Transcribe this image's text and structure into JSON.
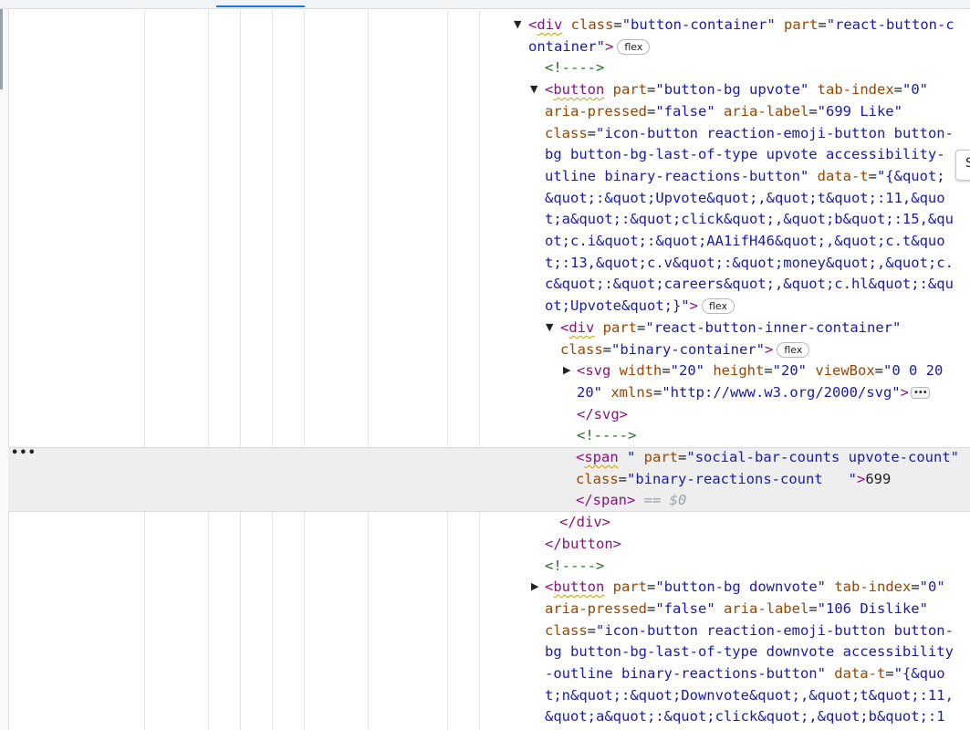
{
  "devtools": {
    "selected_row_menu": "•••",
    "edge_tooltip_text": "S",
    "lines": [
      {
        "toggle": "▼",
        "parts": [
          {
            "c": "tag",
            "t": "<"
          },
          {
            "c": "tag sq",
            "t": "div"
          },
          {
            "c": "an",
            "t": " class"
          },
          {
            "c": "tx",
            "t": "="
          },
          {
            "c": "av",
            "t": "\"button-container\""
          },
          {
            "c": "an",
            "t": " part"
          },
          {
            "c": "tx",
            "t": "="
          },
          {
            "c": "av",
            "t": "\"react-button-c"
          }
        ]
      },
      {
        "parts": [
          {
            "c": "av",
            "t": "ontainer\""
          },
          {
            "c": "tag",
            "t": ">"
          },
          {
            "c": "badge",
            "t": "flex"
          }
        ]
      },
      {
        "parts": [
          {
            "c": "cm",
            "t": "<!---->"
          }
        ]
      },
      {
        "toggle": "▼",
        "parts": [
          {
            "c": "tag",
            "t": "<"
          },
          {
            "c": "tag sq",
            "t": "button"
          },
          {
            "c": "an",
            "t": " part"
          },
          {
            "c": "tx",
            "t": "="
          },
          {
            "c": "av",
            "t": "\"button-bg upvote\""
          },
          {
            "c": "an",
            "t": " tab-index"
          },
          {
            "c": "tx",
            "t": "="
          },
          {
            "c": "av",
            "t": "\"0\""
          }
        ]
      },
      {
        "parts": [
          {
            "c": "an",
            "t": "aria-pressed"
          },
          {
            "c": "tx",
            "t": "="
          },
          {
            "c": "av",
            "t": "\"false\""
          },
          {
            "c": "an",
            "t": " aria-label"
          },
          {
            "c": "tx",
            "t": "="
          },
          {
            "c": "av",
            "t": "\"699 Like\""
          }
        ]
      },
      {
        "parts": [
          {
            "c": "an",
            "t": "class"
          },
          {
            "c": "tx",
            "t": "="
          },
          {
            "c": "av",
            "t": "\"icon-button reaction-emoji-button button-"
          }
        ]
      },
      {
        "parts": [
          {
            "c": "av",
            "t": "bg button-bg-last-of-type upvote accessibility-"
          }
        ]
      },
      {
        "parts": [
          {
            "c": "av",
            "t": "utline binary-reactions-button\""
          },
          {
            "c": "an",
            "t": " data-t"
          },
          {
            "c": "tx",
            "t": "="
          },
          {
            "c": "av",
            "t": "\"{&quot;"
          }
        ]
      },
      {
        "parts": [
          {
            "c": "av",
            "t": "&quot;:&quot;Upvote&quot;,&quot;t&quot;:11,&quo"
          }
        ]
      },
      {
        "parts": [
          {
            "c": "av",
            "t": "t;a&quot;:&quot;click&quot;,&quot;b&quot;:15,&qu"
          }
        ]
      },
      {
        "parts": [
          {
            "c": "av",
            "t": "ot;c.i&quot;:&quot;AA1ifH46&quot;,&quot;c.t&quo"
          }
        ]
      },
      {
        "parts": [
          {
            "c": "av",
            "t": "t;:13,&quot;c.v&quot;:&quot;money&quot;,&quot;c."
          }
        ]
      },
      {
        "parts": [
          {
            "c": "av",
            "t": "c&quot;:&quot;careers&quot;,&quot;c.hl&quot;:&qu"
          }
        ]
      },
      {
        "parts": [
          {
            "c": "av",
            "t": "ot;Upvote&quot;}\""
          },
          {
            "c": "tag",
            "t": ">"
          },
          {
            "c": "badge",
            "t": "flex"
          }
        ]
      },
      {
        "toggle": "▼",
        "parts": [
          {
            "c": "tag",
            "t": "<"
          },
          {
            "c": "tag sq",
            "t": "div"
          },
          {
            "c": "an",
            "t": " part"
          },
          {
            "c": "tx",
            "t": "="
          },
          {
            "c": "av",
            "t": "\"react-button-inner-container\""
          }
        ]
      },
      {
        "parts": [
          {
            "c": "an",
            "t": "class"
          },
          {
            "c": "tx",
            "t": "="
          },
          {
            "c": "av",
            "t": "\"binary-container\""
          },
          {
            "c": "tag",
            "t": ">"
          },
          {
            "c": "badge",
            "t": "flex"
          }
        ]
      },
      {
        "toggle": "▶",
        "parts": [
          {
            "c": "tag",
            "t": "<svg"
          },
          {
            "c": "an",
            "t": " width"
          },
          {
            "c": "tx",
            "t": "="
          },
          {
            "c": "av",
            "t": "\"20\""
          },
          {
            "c": "an",
            "t": " height"
          },
          {
            "c": "tx",
            "t": "="
          },
          {
            "c": "av",
            "t": "\"20\""
          },
          {
            "c": "an",
            "t": " viewBox"
          },
          {
            "c": "tx",
            "t": "="
          },
          {
            "c": "av",
            "t": "\"0 0 20"
          }
        ]
      },
      {
        "parts": [
          {
            "c": "av",
            "t": "20\""
          },
          {
            "c": "an",
            "t": " xmlns"
          },
          {
            "c": "tx",
            "t": "="
          },
          {
            "c": "av",
            "t": "\"http://www.w3.org/2000/svg\""
          },
          {
            "c": "tag",
            "t": ">"
          },
          {
            "c": "dots",
            "t": "•••"
          }
        ]
      },
      {
        "parts": [
          {
            "c": "tag",
            "t": "</svg>"
          }
        ]
      },
      {
        "parts": [
          {
            "c": "cm",
            "t": "<!---->"
          }
        ]
      },
      {
        "parts": [
          {
            "c": "tag",
            "t": "<"
          },
          {
            "c": "tag sq",
            "t": "span"
          },
          {
            "c": "av",
            "t": " \""
          },
          {
            "c": "an",
            "t": " part"
          },
          {
            "c": "tx",
            "t": "="
          },
          {
            "c": "av",
            "t": "\"social-bar-counts upvote-count\""
          }
        ]
      },
      {
        "parts": [
          {
            "c": "an",
            "t": "class"
          },
          {
            "c": "tx",
            "t": "="
          },
          {
            "c": "av",
            "t": "\"binary-reactions-count   \""
          },
          {
            "c": "tag",
            "t": ">"
          },
          {
            "c": "tx",
            "t": "699"
          }
        ]
      },
      {
        "parts": [
          {
            "c": "tag",
            "t": "</span>"
          },
          {
            "c": "dim",
            "t": " == $0"
          }
        ]
      },
      {
        "parts": [
          {
            "c": "tag",
            "t": "</div>"
          }
        ]
      },
      {
        "parts": [
          {
            "c": "tag",
            "t": "</button>"
          }
        ]
      },
      {
        "parts": [
          {
            "c": "cm",
            "t": "<!---->"
          }
        ]
      },
      {
        "toggle": "▶",
        "parts": [
          {
            "c": "tag",
            "t": "<"
          },
          {
            "c": "tag sq",
            "t": "button"
          },
          {
            "c": "an",
            "t": " part"
          },
          {
            "c": "tx",
            "t": "="
          },
          {
            "c": "av",
            "t": "\"button-bg downvote\""
          },
          {
            "c": "an",
            "t": " tab-index"
          },
          {
            "c": "tx",
            "t": "="
          },
          {
            "c": "av",
            "t": "\"0\""
          }
        ]
      },
      {
        "parts": [
          {
            "c": "an",
            "t": "aria-pressed"
          },
          {
            "c": "tx",
            "t": "="
          },
          {
            "c": "av",
            "t": "\"false\""
          },
          {
            "c": "an",
            "t": " aria-label"
          },
          {
            "c": "tx",
            "t": "="
          },
          {
            "c": "av",
            "t": "\"106 Dislike\""
          }
        ]
      },
      {
        "parts": [
          {
            "c": "an",
            "t": "class"
          },
          {
            "c": "tx",
            "t": "="
          },
          {
            "c": "av",
            "t": "\"icon-button reaction-emoji-button button-"
          }
        ]
      },
      {
        "parts": [
          {
            "c": "av",
            "t": "bg button-bg-last-of-type downvote accessibility"
          }
        ]
      },
      {
        "parts": [
          {
            "c": "av",
            "t": "-outline binary-reactions-button\""
          },
          {
            "c": "an",
            "t": " data-t"
          },
          {
            "c": "tx",
            "t": "="
          },
          {
            "c": "av",
            "t": "\"{&quo"
          }
        ]
      },
      {
        "parts": [
          {
            "c": "av",
            "t": "t;n&quot;:&quot;Downvote&quot;,&quot;t&quot;:11,"
          }
        ]
      },
      {
        "parts": [
          {
            "c": "av",
            "t": "&quot;a&quot;:&quot;click&quot;,&quot;b&quot;:1"
          }
        ]
      }
    ]
  }
}
